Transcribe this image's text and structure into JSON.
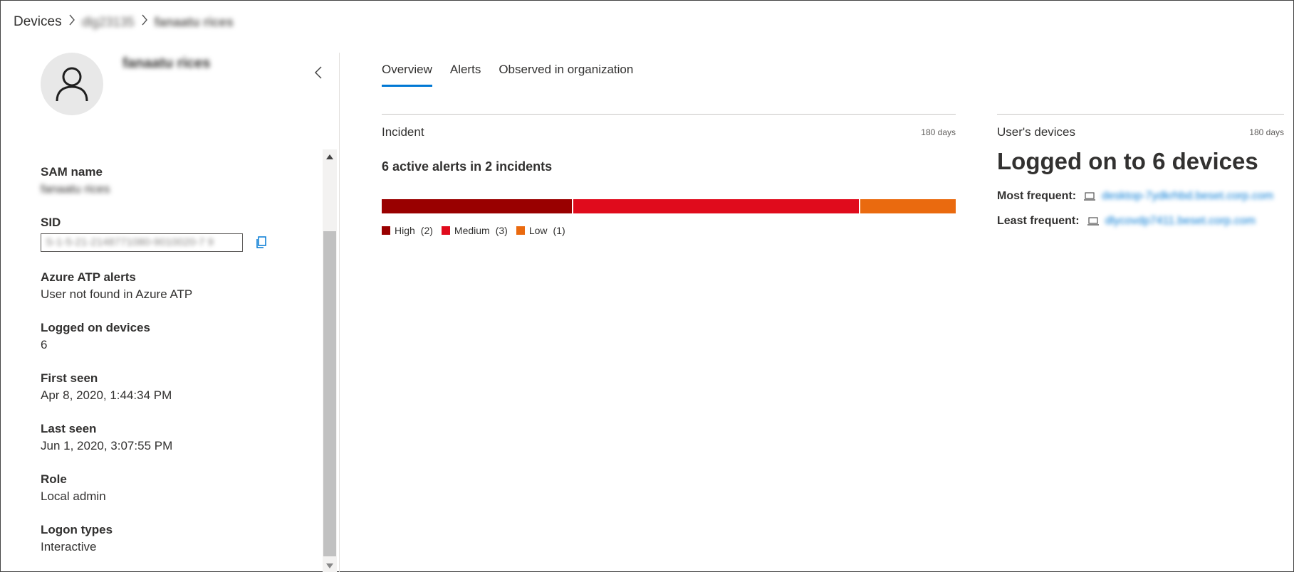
{
  "breadcrumb": {
    "root": "Devices",
    "device": "dlg23135",
    "user": "fanaatu rices"
  },
  "user": {
    "name": "fanaatu rices"
  },
  "properties": {
    "sam_name": {
      "label": "SAM name",
      "value": "fanaatu rices"
    },
    "sid": {
      "label": "SID",
      "value": "S-1-5-21-2148771080-9010020-7 9"
    },
    "azure_atp": {
      "label": "Azure ATP alerts",
      "value": "User not found in Azure ATP"
    },
    "logged_on_devices": {
      "label": "Logged on devices",
      "value": "6"
    },
    "first_seen": {
      "label": "First seen",
      "value": "Apr 8, 2020, 1:44:34 PM"
    },
    "last_seen": {
      "label": "Last seen",
      "value": "Jun 1, 2020, 3:07:55 PM"
    },
    "role": {
      "label": "Role",
      "value": "Local admin"
    },
    "logon_types": {
      "label": "Logon types",
      "value": "Interactive"
    }
  },
  "tabs": [
    {
      "label": "Overview",
      "active": true
    },
    {
      "label": "Alerts",
      "active": false
    },
    {
      "label": "Observed in organization",
      "active": false
    }
  ],
  "incident": {
    "title": "Incident",
    "range": "180 days",
    "headline": "6 active alerts  in 2 incidents",
    "severity": [
      {
        "name": "High",
        "count": 2,
        "count_label": "(2)",
        "color": "#990000"
      },
      {
        "name": "Medium",
        "count": 3,
        "count_label": "(3)",
        "color": "#e00b1c"
      },
      {
        "name": "Low",
        "count": 1,
        "count_label": "(1)",
        "color": "#ea6a0f"
      }
    ]
  },
  "devices": {
    "title": "User's devices",
    "range": "180 days",
    "headline": "Logged on to 6 devices",
    "most_frequent_label": "Most frequent:",
    "most_frequent_value": "desktop-7ydkrhbd.beset.corp.com",
    "least_frequent_label": "Least frequent:",
    "least_frequent_value": "dlycovdp7411.beset.corp.com",
    "device_icon": "laptop-icon"
  },
  "colors": {
    "accent": "#0078d4",
    "high": "#990000",
    "medium": "#e00b1c",
    "low": "#ea6a0f"
  }
}
